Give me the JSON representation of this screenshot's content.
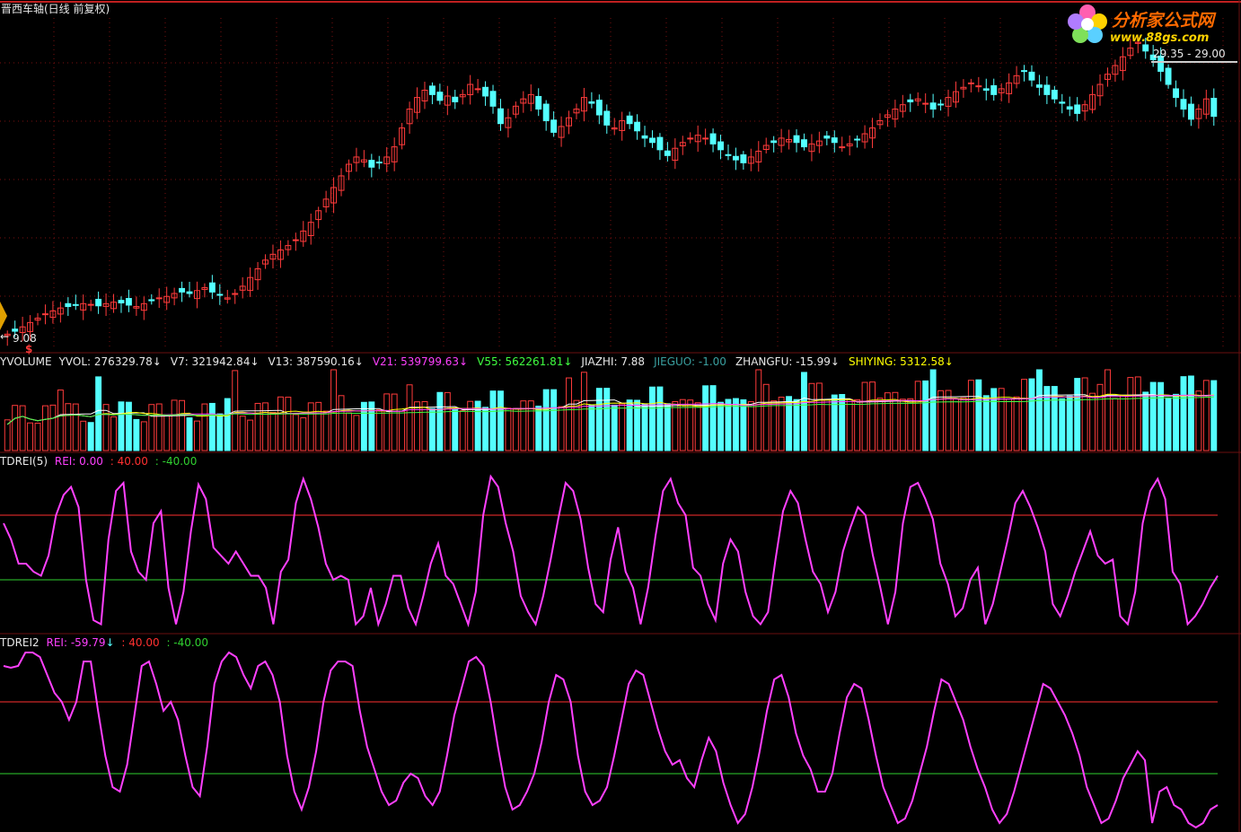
{
  "window": {
    "title": "晋西车轴(日线 前复权)"
  },
  "logo": {
    "name": "分析家公式网",
    "url": "www.88gs.com"
  },
  "colors": {
    "bg": "#000000",
    "up": "#ff3b3b",
    "down": "#54ffff",
    "grid": "#7a1010",
    "rei_line": "#ff40ff",
    "level_high": "#ff3030",
    "level_low": "#30d030",
    "ma7": "#ffffff",
    "ma13": "#ffff00",
    "ma21": "#ff40ff",
    "ma55": "#40ff40"
  },
  "price_panel": {
    "range_label": "29.35 - 29.00",
    "low_label": "9.08",
    "low_marker": "$"
  },
  "volume_panel": {
    "indicator": "YVOLUME",
    "items": [
      {
        "label": "YVOL: 276329.78",
        "arrow": "↓",
        "color": "#e8e8e8"
      },
      {
        "label": "V7: 321942.84",
        "arrow": "↓",
        "color": "#e8e8e8"
      },
      {
        "label": "V13: 387590.16",
        "arrow": "↓",
        "color": "#e8e8e8"
      },
      {
        "label": "V21: 539799.63",
        "arrow": "↓",
        "color": "#ff40ff"
      },
      {
        "label": "V55: 562261.81",
        "arrow": "↓",
        "color": "#40ff40"
      },
      {
        "label": "JIAZHI: 7.88",
        "arrow": "",
        "color": "#e8e8e8"
      },
      {
        "label": "JIEGUO: -1.00",
        "arrow": "",
        "color": "#3aa0a0"
      },
      {
        "label": "ZHANGFU: -15.99",
        "arrow": "↓",
        "color": "#e8e8e8"
      },
      {
        "label": "SHIYING: 5312.58",
        "arrow": "↓",
        "color": "#ffff00"
      }
    ]
  },
  "rei_panel_1": {
    "indicator": "TDREI(5)",
    "rei_label": "REI: 0.00",
    "rei_arrow": "",
    "upper_label": ": 40.00",
    "lower_label": ": -40.00"
  },
  "rei_panel_2": {
    "indicator": "TDREI2",
    "rei_label": "REI: -59.79",
    "rei_arrow": "↓",
    "upper_label": ": 40.00",
    "lower_label": ": -40.00"
  },
  "chart_data": [
    {
      "type": "candlestick",
      "title": "晋西车轴(日线 前复权)",
      "ylim": [
        8.5,
        31
      ],
      "annotations": [
        "29.35 - 29.00",
        "9.08"
      ],
      "close": [
        9.1,
        9.3,
        9.6,
        9.9,
        10.2,
        10.5,
        10.7,
        10.9,
        11.0,
        11.1,
        11.2,
        11.15,
        11.05,
        11.2,
        11.3,
        11.25,
        11.1,
        11.0,
        11.2,
        11.4,
        11.6,
        11.7,
        11.9,
        12.0,
        11.9,
        12.1,
        12.3,
        12.0,
        11.8,
        11.6,
        11.9,
        12.4,
        13.0,
        13.6,
        14.2,
        14.6,
        14.9,
        15.2,
        15.6,
        16.2,
        16.8,
        17.6,
        18.4,
        19.2,
        20.0,
        20.8,
        21.3,
        21.1,
        20.6,
        20.9,
        21.3,
        22.0,
        23.3,
        24.6,
        25.4,
        25.9,
        25.6,
        25.2,
        25.5,
        25.1,
        25.6,
        26.3,
        26.0,
        25.5,
        24.8,
        23.6,
        24.0,
        24.8,
        25.3,
        25.6,
        24.6,
        23.8,
        23.0,
        23.4,
        24.0,
        24.6,
        25.4,
        25.0,
        24.2,
        23.5,
        23.3,
        23.8,
        23.6,
        23.1,
        22.6,
        22.3,
        21.8,
        21.4,
        21.9,
        22.3,
        22.6,
        22.8,
        22.6,
        22.2,
        21.8,
        21.4,
        21.1,
        20.9,
        21.3,
        21.7,
        22.1,
        22.3,
        22.6,
        22.5,
        22.3,
        22.0,
        22.2,
        22.4,
        22.6,
        22.3,
        22.0,
        22.2,
        22.5,
        22.9,
        23.3,
        23.8,
        24.2,
        24.6,
        24.9,
        25.1,
        25.3,
        25.0,
        24.6,
        24.9,
        25.4,
        25.8,
        26.1,
        26.4,
        26.2,
        25.9,
        25.6,
        26.0,
        26.4,
        26.9,
        27.2,
        26.6,
        26.1,
        25.6,
        25.3,
        25.0,
        24.6,
        24.3,
        24.9,
        25.6,
        26.3,
        27.0,
        27.6,
        28.2,
        28.8,
        29.2,
        28.6,
        28.0,
        27.2,
        26.3,
        25.4,
        24.6,
        23.9,
        24.6,
        25.3,
        24.1
      ],
      "unit": "price"
    },
    {
      "type": "bar",
      "title": "YVOLUME",
      "series_names": [
        "YVOL",
        "V7",
        "V13",
        "V21",
        "V55"
      ],
      "values": [
        {
          "name": "YVOL",
          "last": 276329.78
        },
        {
          "name": "V7",
          "last": 321942.84
        },
        {
          "name": "V13",
          "last": 387590.16
        },
        {
          "name": "V21",
          "last": 539799.63
        },
        {
          "name": "V55",
          "last": 562261.81
        }
      ]
    },
    {
      "type": "line",
      "title": "TDREI(5)",
      "ylim": [
        -100,
        100
      ],
      "reference_lines": [
        40,
        -40
      ],
      "series": [
        {
          "name": "REI",
          "values": [
            30,
            10,
            -20,
            -20,
            -30,
            -35,
            -10,
            40,
            65,
            75,
            50,
            -40,
            -90,
            -95,
            10,
            70,
            80,
            -5,
            -30,
            -40,
            30,
            45,
            -50,
            -95,
            -55,
            20,
            78,
            60,
            0,
            -10,
            -20,
            -5,
            -20,
            -35,
            -35,
            -50,
            -95,
            -30,
            -15,
            55,
            85,
            60,
            25,
            -20,
            -40,
            -35,
            -40,
            -95,
            -85,
            -50,
            -95,
            -70,
            -35,
            -35,
            -75,
            -95,
            -60,
            -20,
            5,
            -35,
            -45,
            -70,
            -95,
            -55,
            40,
            88,
            75,
            30,
            -5,
            -60,
            -80,
            -95,
            -60,
            -15,
            35,
            80,
            70,
            35,
            -25,
            -70,
            -80,
            -15,
            25,
            -30,
            -50,
            -95,
            -50,
            15,
            70,
            85,
            55,
            40,
            -25,
            -35,
            -70,
            -90,
            -20,
            10,
            -5,
            -55,
            -85,
            -95,
            -80,
            -15,
            45,
            70,
            55,
            10,
            -30,
            -45,
            -80,
            -55,
            -5,
            25,
            50,
            40,
            -10,
            -50,
            -95,
            -55,
            30,
            75,
            80,
            60,
            35,
            -20,
            -45,
            -85,
            -75,
            -40,
            -25,
            -95,
            -70,
            -30,
            10,
            55,
            70,
            50,
            25,
            -5,
            -70,
            -85,
            -60,
            -30,
            -5,
            20,
            -10,
            -20,
            -15,
            -85,
            -95,
            -55,
            30,
            70,
            85,
            60,
            -30,
            -45,
            -95,
            -85,
            -70,
            -50,
            -35
          ]
        }
      ]
    },
    {
      "type": "line",
      "title": "TDREI2",
      "ylim": [
        -100,
        100
      ],
      "reference_lines": [
        40,
        -40
      ],
      "series": [
        {
          "name": "REI",
          "values": [
            80,
            78,
            80,
            95,
            95,
            90,
            70,
            50,
            40,
            20,
            40,
            85,
            85,
            30,
            -20,
            -55,
            -60,
            -30,
            25,
            80,
            85,
            60,
            30,
            40,
            20,
            -20,
            -55,
            -65,
            -10,
            60,
            85,
            95,
            90,
            70,
            55,
            80,
            85,
            70,
            40,
            -20,
            -60,
            -80,
            -55,
            -15,
            40,
            75,
            85,
            85,
            80,
            30,
            -10,
            -35,
            -60,
            -75,
            -70,
            -50,
            -40,
            -45,
            -65,
            -75,
            -60,
            -20,
            25,
            55,
            85,
            90,
            80,
            40,
            -10,
            -55,
            -80,
            -75,
            -60,
            -40,
            -5,
            40,
            70,
            65,
            40,
            -20,
            -60,
            -75,
            -70,
            -55,
            -20,
            20,
            60,
            75,
            70,
            40,
            10,
            -15,
            -30,
            -25,
            -45,
            -55,
            -25,
            0,
            -15,
            -50,
            -75,
            -95,
            -85,
            -55,
            -15,
            30,
            65,
            70,
            45,
            5,
            -20,
            -35,
            -60,
            -60,
            -40,
            5,
            45,
            60,
            55,
            20,
            -20,
            -55,
            -75,
            -95,
            -90,
            -70,
            -40,
            -10,
            30,
            65,
            60,
            40,
            20,
            -10,
            -35,
            -55,
            -80,
            -95,
            -85,
            -60,
            -30,
            0,
            30,
            60,
            55,
            40,
            25,
            5,
            -20,
            -55,
            -75,
            -95,
            -90,
            -70,
            -45,
            -30,
            -15,
            -25,
            -95,
            -60,
            -55,
            -75,
            -80,
            -95,
            -100,
            -95,
            -80,
            -75
          ]
        }
      ]
    }
  ]
}
